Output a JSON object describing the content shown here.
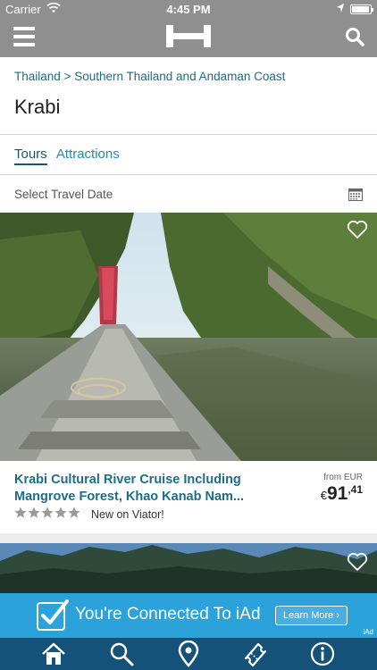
{
  "status_bar": {
    "carrier": "Carrier",
    "time": "4:45 PM",
    "icons": [
      "wifi-icon",
      "location-arrow-icon",
      "battery-icon"
    ]
  },
  "nav_bar": {
    "icons": [
      "menu-icon",
      "hotels-logo-icon",
      "search-icon"
    ]
  },
  "breadcrumb": {
    "items": [
      "Thailand",
      "Southern Thailand and Andaman Coast"
    ],
    "separator": ">"
  },
  "page": {
    "title": "Krabi"
  },
  "tabs": [
    {
      "label": "Tours",
      "active": true
    },
    {
      "label": "Attractions",
      "active": false
    }
  ],
  "date_picker": {
    "label": "Select Travel Date",
    "icon": "calendar-icon"
  },
  "tour": {
    "title_line1": "Krabi Cultural River Cruise Including",
    "title_line2": "Mangrove Forest, Khao Kanab Nam...",
    "price_label": "from EUR",
    "currency_symbol": "€",
    "price_whole": "91",
    "price_fraction": ",41",
    "rating_stars": 5,
    "review_text": "New on Viator!",
    "favorite_icon": "heart-outline-icon"
  },
  "ad": {
    "text": "You're Connected To iAd",
    "button_label": "Learn More ›",
    "tag": "iAd"
  },
  "tab_bar": {
    "icons": [
      "home-icon",
      "search-icon",
      "map-pin-icon",
      "ticket-icon",
      "info-icon"
    ]
  },
  "colors": {
    "nav_gray": "#8f8f8f",
    "link_blue": "#1a6e8a",
    "ad_blue": "#2ba2d9",
    "tab_bar_blue": "#14527a"
  }
}
